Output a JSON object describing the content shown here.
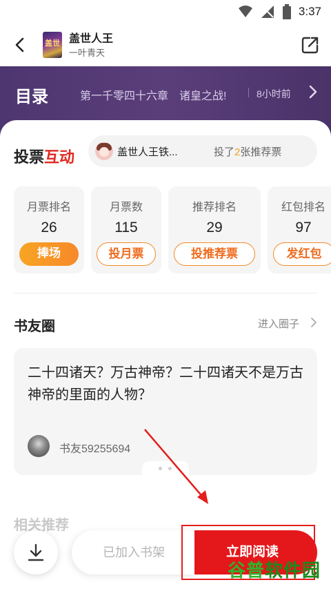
{
  "status_bar": {
    "time": "3:37",
    "icons": [
      "wifi-icon",
      "signal-icon",
      "battery-icon"
    ]
  },
  "header": {
    "book_title": "盖世人王",
    "author": "一叶青天",
    "cover_text": "盖世",
    "back_icon": "chevron-left-icon",
    "share_icon": "share-icon"
  },
  "toc_bar": {
    "title": "目录",
    "latest_chapter": "第一千零四十六章　诸皇之战!",
    "updated": "8小时前"
  },
  "vote": {
    "title_black": "投票",
    "title_red": "互动",
    "fan_name": "盖世人王铁...",
    "fan_vote_prefix": "投了",
    "fan_vote_count": "2",
    "fan_vote_suffix": "张推荐票"
  },
  "stats": [
    {
      "label": "月票排名",
      "value": "26",
      "button": "捧场"
    },
    {
      "label": "月票数",
      "value": "115",
      "button": "投月票"
    },
    {
      "label": "推荐排名",
      "value": "29",
      "button": "投推荐票"
    },
    {
      "label": "红包排名",
      "value": "97",
      "button": "发红包"
    }
  ],
  "circle": {
    "title": "书友圈",
    "enter": "进入圈子",
    "post_text": "二十四诸天？万古神帝？二十四诸天不是万古神帝的里面的人物？",
    "post_user": "书友59255694"
  },
  "related": {
    "title": "相关推荐"
  },
  "bottom": {
    "shelf_label": "已加入书架",
    "read_label": "立即阅读",
    "download_icon": "download-icon"
  },
  "watermark": {
    "part1": "谷普",
    "part2": "软件园"
  },
  "colors": {
    "purple": "#523a74",
    "red": "#e4171b",
    "orange": "#f28a25"
  }
}
